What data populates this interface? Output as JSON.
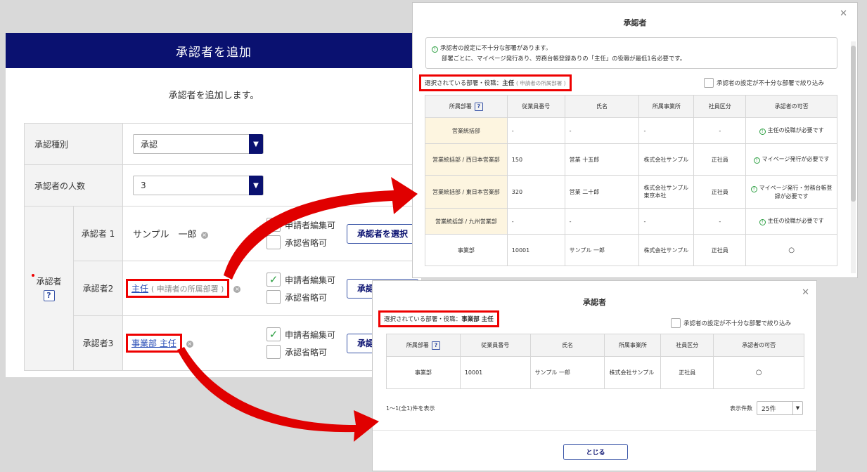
{
  "main": {
    "title": "承認者を追加",
    "subtitle": "承認者を追加します。",
    "approval_type_label": "承認種別",
    "approval_type_value": "承認",
    "approver_count_label": "承認者の人数",
    "approver_count_value": "3",
    "approver_label": "承認者",
    "approvers": [
      {
        "label": "承認者 1",
        "name": "サンプル　一郎",
        "check1": "申請者編集可",
        "check1_checked": true,
        "check2": "承認省略可",
        "check2_checked": false,
        "button": "承認者を選択"
      },
      {
        "label": "承認者2",
        "name": "主任",
        "name_suffix": "( 申請者の所属部署 )",
        "check1": "申請者編集可",
        "check1_checked": true,
        "check2": "承認省略可",
        "check2_checked": false,
        "button": "承認者を選択"
      },
      {
        "label": "承認者3",
        "name": "事業部 主任",
        "check1": "申請者編集可",
        "check1_checked": true,
        "check2": "承認省略可",
        "check2_checked": false,
        "button": "承認者を選択"
      }
    ]
  },
  "modal1": {
    "title": "承認者",
    "notice_line1": "承認者の設定に不十分な部署があります。",
    "notice_line2": "部署ごとに、マイページ発行あり、労務台帳登録ありの「主任」の役職が最低1名必要です。",
    "selected_prefix": "選択されている部署・役職：",
    "selected_value": "主任",
    "selected_note": "( 申請者の所属部署 )",
    "filter_label": "承認者の設定が不十分な部署で絞り込み",
    "columns": [
      "所属部署",
      "従業員番号",
      "氏名",
      "所属事業所",
      "社員区分",
      "承認者の可否"
    ],
    "rows": [
      {
        "dept": "営業統括部",
        "emp_no": "-",
        "name": "-",
        "office": "-",
        "type": "-",
        "status": "主任の役職が必要です",
        "status_icon": true,
        "highlight": true
      },
      {
        "dept": "営業統括部 / 西日本営業部",
        "emp_no": "150",
        "name": "営業 十五郎",
        "office": "株式会社サンプル",
        "type": "正社員",
        "status": "マイページ発行が必要です",
        "status_icon": true,
        "highlight": true
      },
      {
        "dept": "営業統括部 / 東日本営業部",
        "emp_no": "320",
        "name": "営業 二十郎",
        "office": "株式会社サンプル　東京本社",
        "type": "正社員",
        "status": "マイページ発行・労務台帳登録が必要です",
        "status_icon": true,
        "highlight": true
      },
      {
        "dept": "営業統括部 / 九州営業部",
        "emp_no": "-",
        "name": "-",
        "office": "-",
        "type": "-",
        "status": "主任の役職が必要です",
        "status_icon": true,
        "highlight": true
      },
      {
        "dept": "事業部",
        "emp_no": "10001",
        "name": "サンプル 一郎",
        "office": "株式会社サンプル",
        "type": "正社員",
        "status": "○",
        "status_icon": false,
        "highlight": false
      }
    ]
  },
  "modal2": {
    "title": "承認者",
    "selected_prefix": "選択されている部署・役職：",
    "selected_value": "事業部 主任",
    "filter_label": "承認者の設定が不十分な部署で絞り込み",
    "columns": [
      "所属部署",
      "従業員番号",
      "氏名",
      "所属事業所",
      "社員区分",
      "承認者の可否"
    ],
    "rows": [
      {
        "dept": "事業部",
        "emp_no": "10001",
        "name": "サンプル 一郎",
        "office": "株式会社サンプル",
        "type": "正社員",
        "status": "○"
      }
    ],
    "page_info": "1〜1(全1)件を表示",
    "per_page_label": "表示件数",
    "per_page_value": "25件",
    "close_button": "とじる"
  },
  "colors": {
    "header_navy": "#0a1170",
    "highlight_red": "#e00000",
    "link_blue": "#2a4fb8",
    "dept_highlight": "#fdf5e0"
  },
  "icons": [
    "chevron-down-icon",
    "help-icon",
    "check-icon",
    "clear-icon",
    "close-icon",
    "info-circle-icon",
    "arrow-icon"
  ]
}
